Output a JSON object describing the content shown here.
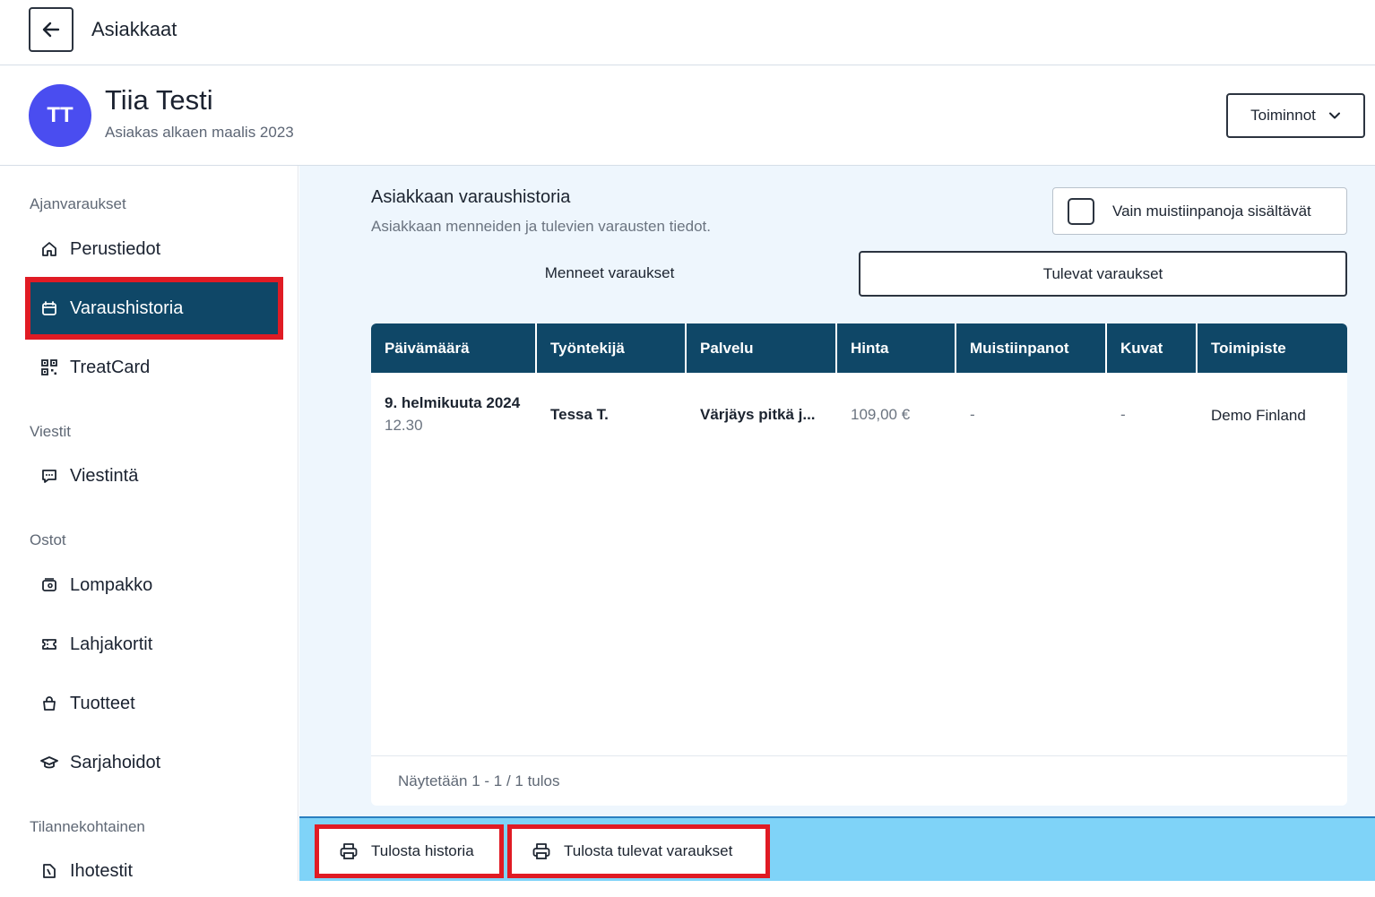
{
  "topbar": {
    "title": "Asiakkaat",
    "back_icon": "arrow-left-icon"
  },
  "profile": {
    "initials": "TT",
    "name": "Tiia Testi",
    "since": "Asiakas alkaen maalis 2023",
    "actions_label": "Toiminnot",
    "avatar_color": "#4a4df0"
  },
  "sidebar": {
    "sections": {
      "appointments": "Ajanvaraukset",
      "messages": "Viestit",
      "purchases": "Ostot",
      "situational": "Tilannekohtainen"
    },
    "items": [
      {
        "label": "Perustiedot",
        "icon": "home-icon"
      },
      {
        "label": "Varaushistoria",
        "icon": "calendar-icon",
        "active": true
      },
      {
        "label": "TreatCard",
        "icon": "qr-code-icon"
      },
      {
        "label": "Viestintä",
        "icon": "chat-icon"
      },
      {
        "label": "Lompakko",
        "icon": "wallet-icon"
      },
      {
        "label": "Lahjakortit",
        "icon": "ticket-icon"
      },
      {
        "label": "Tuotteet",
        "icon": "bag-icon"
      },
      {
        "label": "Sarjahoidot",
        "icon": "graduation-cap-icon"
      },
      {
        "label": "Ihotestit",
        "icon": "test-icon"
      }
    ]
  },
  "main": {
    "title": "Asiakkaan varaushistoria",
    "subtitle": "Asiakkaan menneiden ja tulevien varausten tiedot.",
    "notes_only_label": "Vain muistiinpanoja sisältävät",
    "tabs": {
      "past": "Menneet varaukset",
      "future": "Tulevat varaukset"
    },
    "table": {
      "headers": [
        "Päivämäärä",
        "Työntekijä",
        "Palvelu",
        "Hinta",
        "Muistiinpanot",
        "Kuvat",
        "Toimipiste"
      ],
      "rows": [
        {
          "date": "9. helmikuuta 2024",
          "time": "12.30",
          "employee": "Tessa T.",
          "service": "Värjäys pitkä j...",
          "price": "109,00 €",
          "notes": "-",
          "images": "-",
          "location": "Demo Finland"
        }
      ],
      "footer": "Näytetään 1 - 1 / 1 tulos"
    }
  },
  "bottombar": {
    "print_history": "Tulosta historia",
    "print_upcoming": "Tulosta tulevat varaukset"
  },
  "colors": {
    "primary": "#0f4767",
    "highlight": "#e01b24",
    "bottombar": "#7fd3f8",
    "main_bg": "#eef6fd"
  }
}
